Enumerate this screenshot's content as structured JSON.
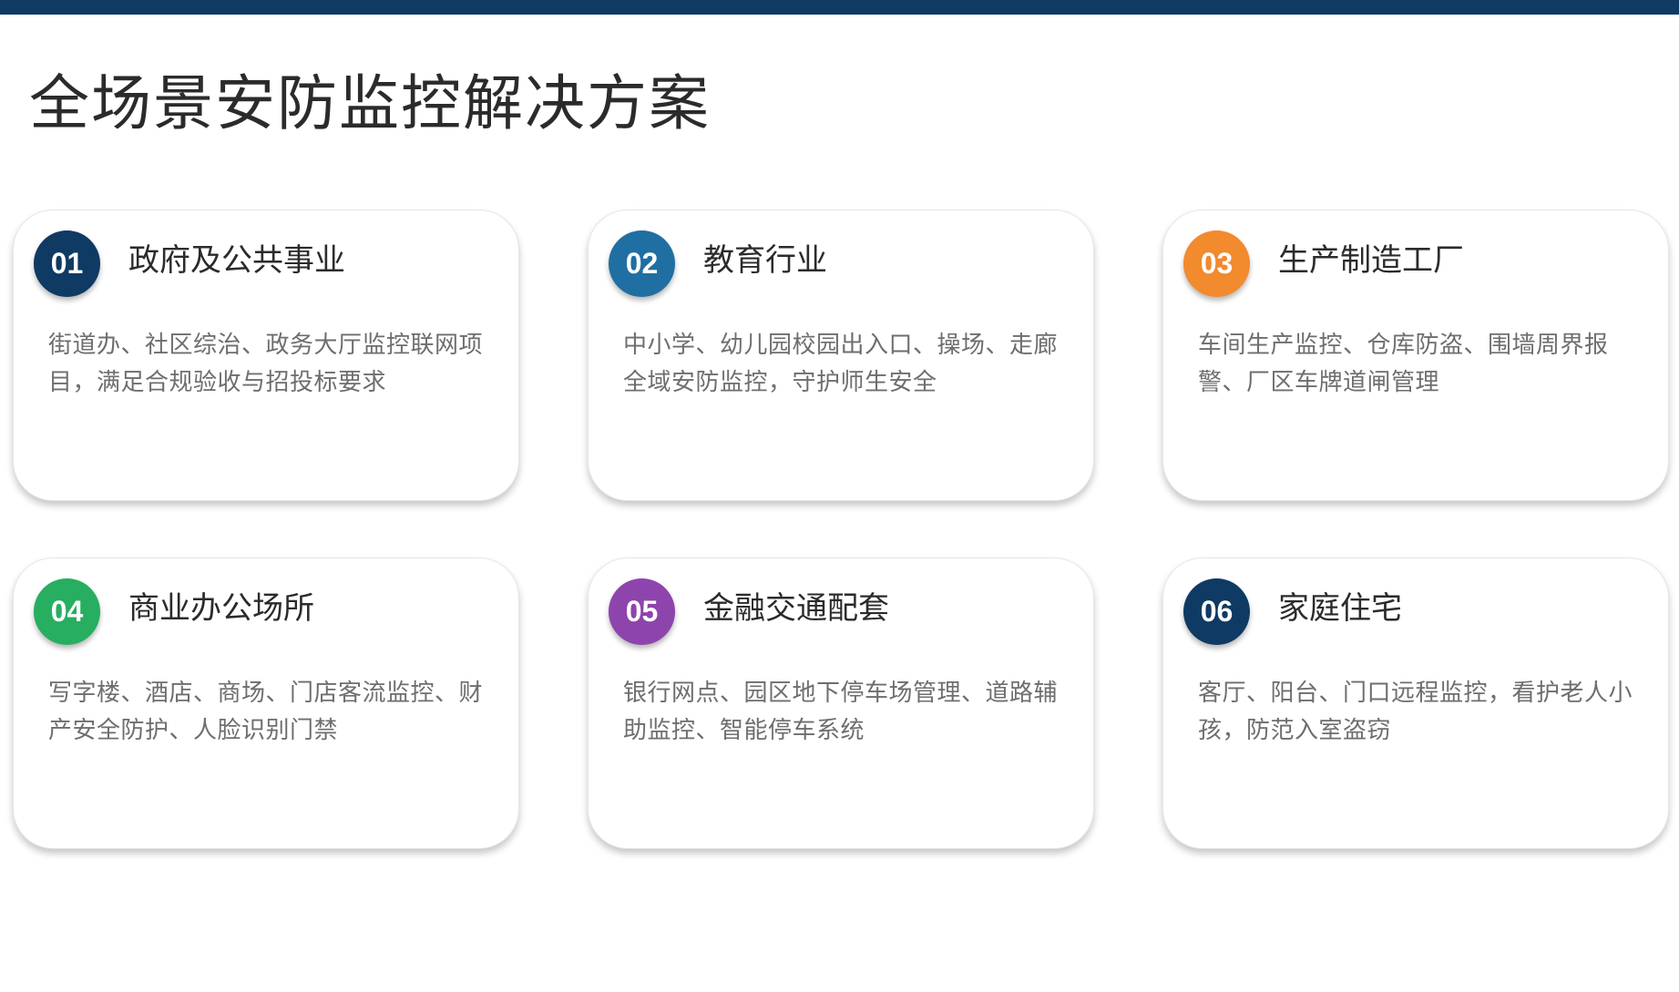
{
  "page": {
    "title": "全场景安防监控解决方案"
  },
  "colors": {
    "top_bar": "#0f3a63",
    "title_text": "#2b2b2b",
    "description_text": "#6e6e6e"
  },
  "cards": [
    {
      "number": "01",
      "title": "政府及公共事业",
      "description": "街道办、社区综治、政务大厅监控联网项目，满足合规验收与招投标要求",
      "badge_color": "#0f3a63"
    },
    {
      "number": "02",
      "title": "教育行业",
      "description": "中小学、幼儿园校园出入口、操场、走廊全域安防监控，守护师生安全",
      "badge_color": "#1f6fa3"
    },
    {
      "number": "03",
      "title": "生产制造工厂",
      "description": "车间生产监控、仓库防盗、围墙周界报警、厂区车牌道闸管理",
      "badge_color": "#f28a2e"
    },
    {
      "number": "04",
      "title": "商业办公场所",
      "description": "写字楼、酒店、商场、门店客流监控、财产安全防护、人脸识别门禁",
      "badge_color": "#27ae60"
    },
    {
      "number": "05",
      "title": "金融交通配套",
      "description": "银行网点、园区地下停车场管理、道路辅助监控、智能停车系统",
      "badge_color": "#8e44ad"
    },
    {
      "number": "06",
      "title": "家庭住宅",
      "description": "客厅、阳台、门口远程监控，看护老人小孩，防范入室盗窃",
      "badge_color": "#0f3a63"
    }
  ]
}
